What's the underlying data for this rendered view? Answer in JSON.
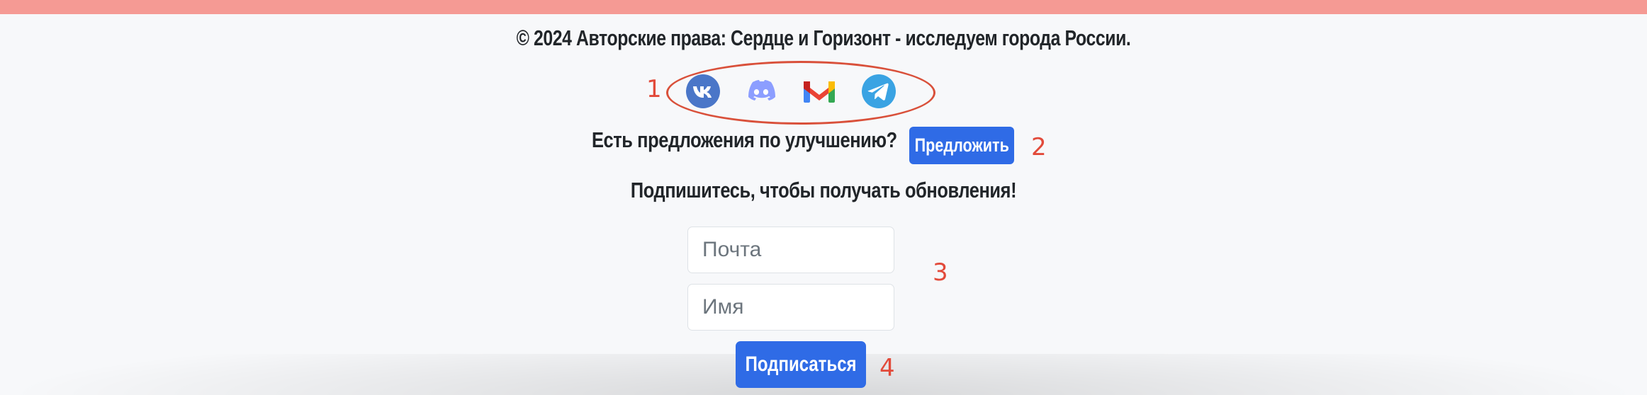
{
  "footer": {
    "copyright": "© 2024 Авторские права: Сердце и Горизонт - исследуем города России."
  },
  "social": {
    "icons": [
      "vk-icon",
      "discord-icon",
      "gmail-icon",
      "telegram-icon"
    ],
    "colors": {
      "vk": "#4a76c8",
      "discord": "#8c9eff",
      "telegram": "#3aa3e3"
    }
  },
  "suggestion": {
    "prompt": "Есть предложения по улучшению?",
    "button_label": "Предложить"
  },
  "subscribe": {
    "heading": "Подпишитесь, чтобы получать обновления!",
    "email_placeholder": "Почта",
    "name_placeholder": "Имя",
    "button_label": "Подписаться"
  },
  "annotations": {
    "markers": [
      "1",
      "2",
      "3",
      "4"
    ],
    "color": "#e24a3a"
  },
  "theme": {
    "accent": "#2f6be6",
    "top_bar": "#f59a94",
    "background": "#f7f8fa"
  }
}
